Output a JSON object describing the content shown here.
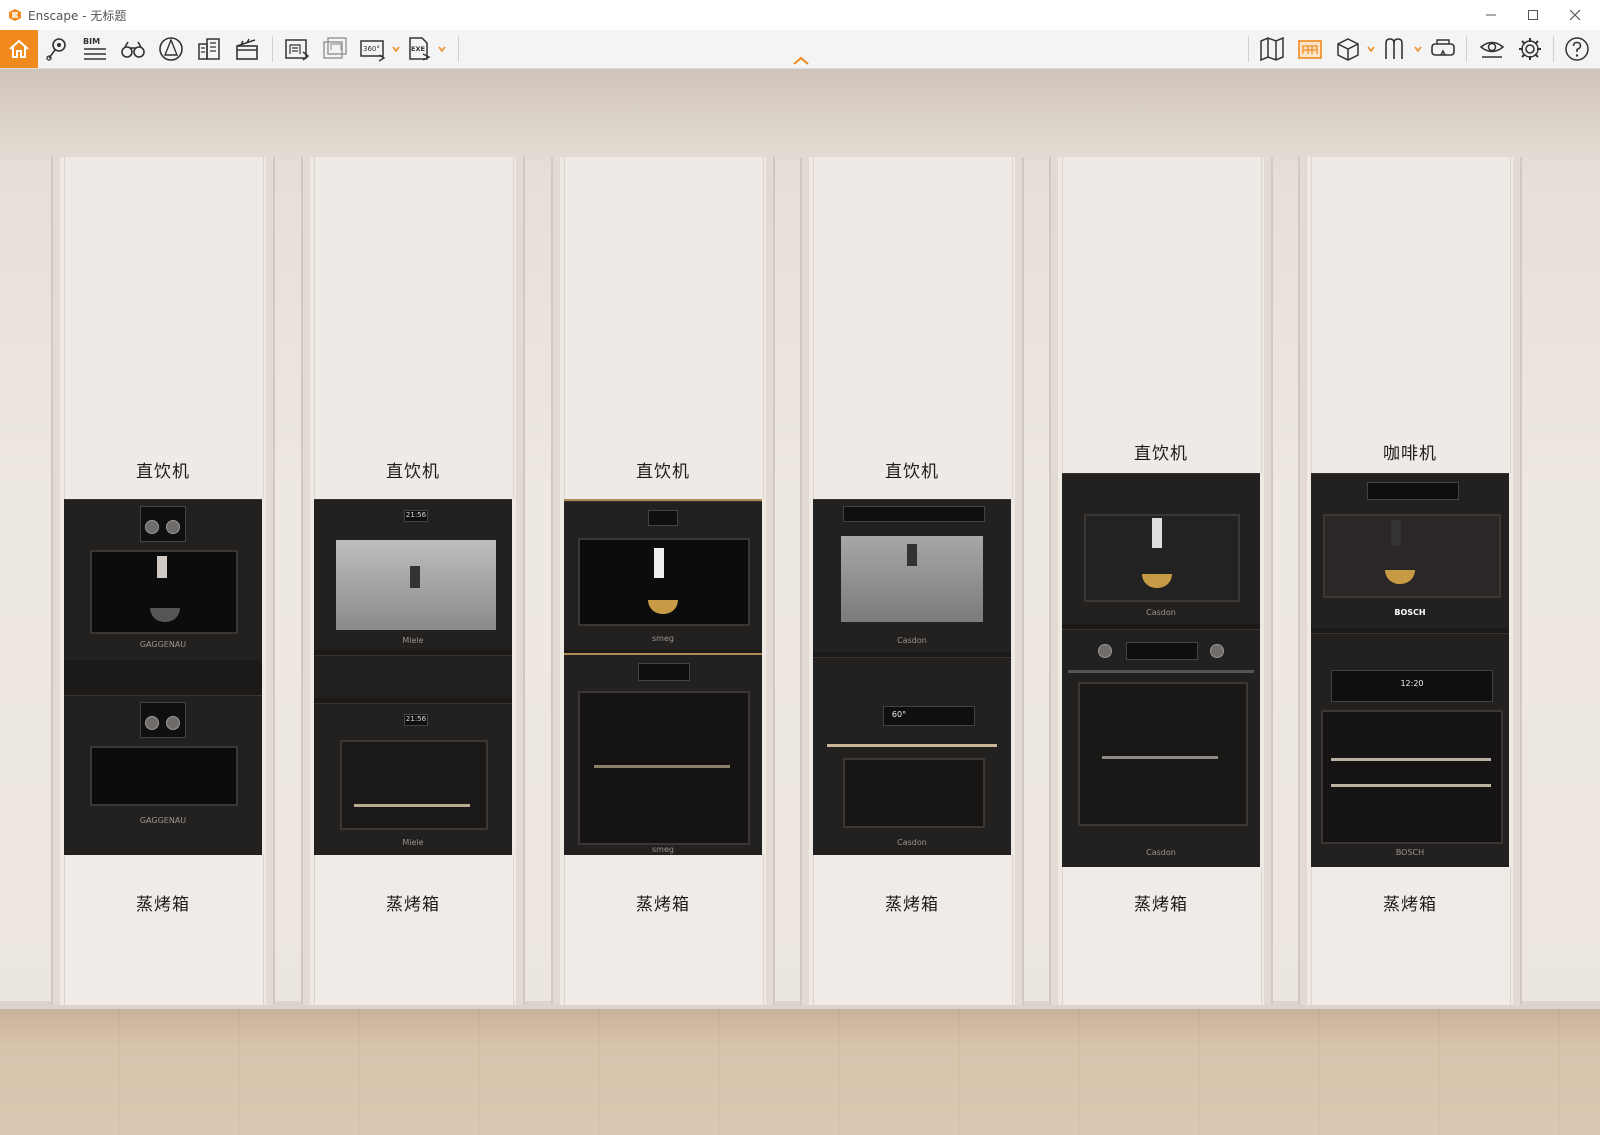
{
  "window": {
    "title": "Enscape - 无标题",
    "controls": [
      "minimize",
      "maximize",
      "close"
    ]
  },
  "toolbar": {
    "left_tools": [
      "home-icon",
      "location-pin-icon",
      "bim-list-icon",
      "binoculars-icon",
      "atmosphere-icon",
      "buildings-icon",
      "clapperboard-icon",
      "render-screenshot-icon",
      "batch-render-icon",
      "panorama-360-icon",
      "export-exe-icon"
    ],
    "right_tools": [
      "map-icon",
      "asset-library-icon",
      "view-cube-icon",
      "material-editor-icon",
      "vr-headset-icon",
      "visual-settings-icon",
      "settings-gear-icon",
      "help-icon"
    ],
    "bim_label": "BIM",
    "pano_label": "360°",
    "exe_label": "EXE"
  },
  "scene": {
    "columns": [
      {
        "top_label": "直饮机",
        "bottom_label": "蒸烤箱",
        "brand_top": "GAGGENAU",
        "brand_bottom": "GAGGENAU"
      },
      {
        "top_label": "直饮机",
        "bottom_label": "蒸烤箱",
        "brand_top": "Miele",
        "brand_bottom": "Miele"
      },
      {
        "top_label": "直饮机",
        "bottom_label": "蒸烤箱",
        "brand_top": "smeg",
        "brand_bottom": "smeg"
      },
      {
        "top_label": "直饮机",
        "bottom_label": "蒸烤箱",
        "brand_top": "Casdon",
        "brand_bottom": "Casdon"
      },
      {
        "top_label": "直饮机",
        "bottom_label": "蒸烤箱",
        "brand_top": "Casdon",
        "brand_bottom": "Casdon"
      },
      {
        "top_label": "咖啡机",
        "bottom_label": "蒸烤箱",
        "brand_top": "BOSCH",
        "brand_bottom": "BOSCH"
      }
    ],
    "displays": [
      "21:56",
      "21:56",
      "60°",
      "12:20"
    ]
  },
  "colors": {
    "accent": "#f08a1e",
    "wall": "#ece5de",
    "cabinet": "#efeae5",
    "appliance": "#1c1a19",
    "floor": "#d8c3ad"
  }
}
